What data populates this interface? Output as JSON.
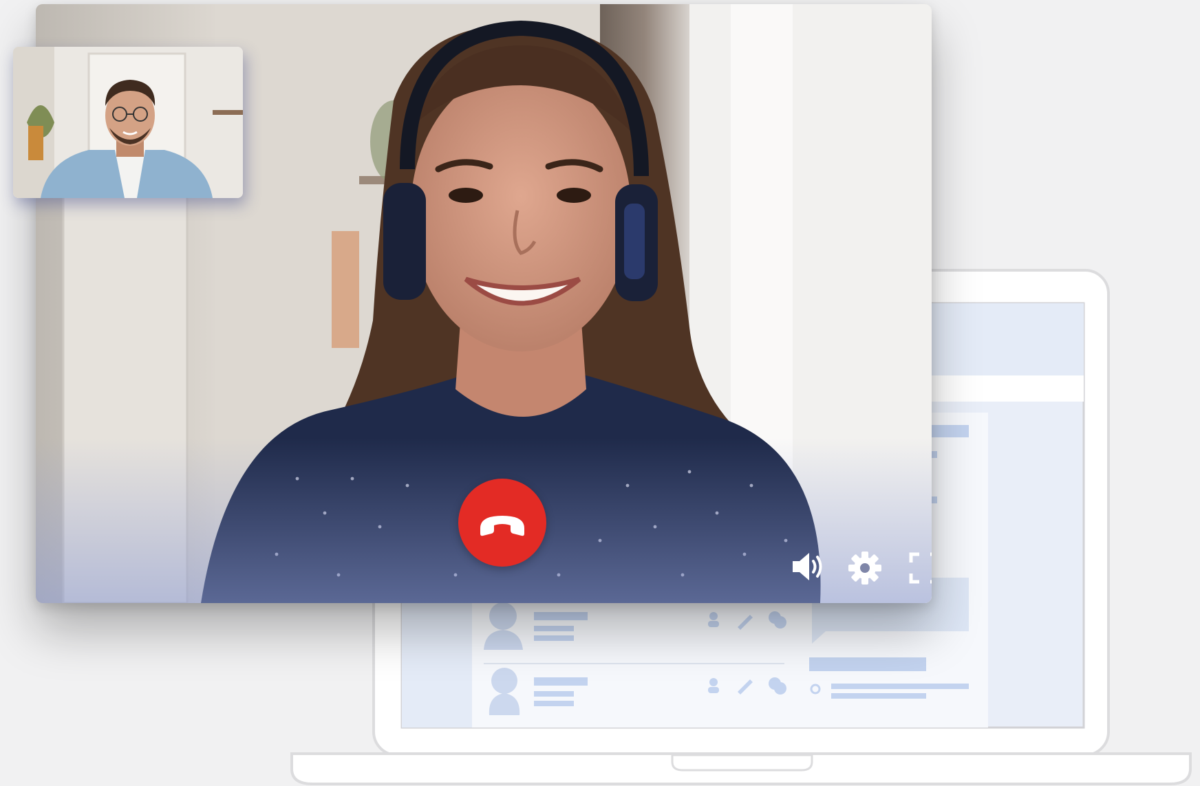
{
  "call": {
    "controls": {
      "end_call": "end-call-icon",
      "speaker": "speaker-icon",
      "settings": "gear-icon",
      "fullscreen": "fullscreen-icon"
    }
  },
  "colors": {
    "end_call": "#e32b25",
    "laptop_outline": "#d9d9db",
    "screen_accent": "#c3d3ef",
    "background": "#f1f1f2"
  }
}
